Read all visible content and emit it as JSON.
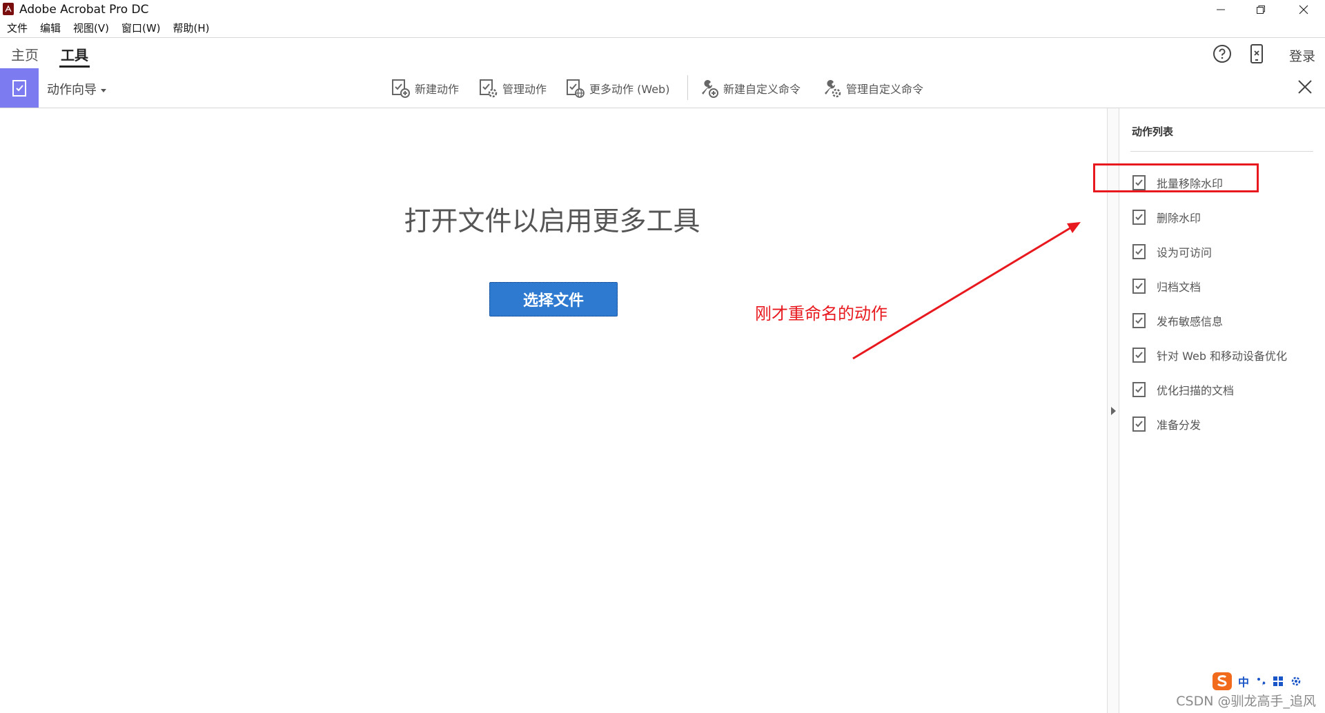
{
  "app": {
    "title": "Adobe Acrobat Pro DC",
    "logo_icon": "acrobat-logo"
  },
  "menu": [
    "文件",
    "编辑",
    "视图(V)",
    "窗口(W)",
    "帮助(H)"
  ],
  "tabs": {
    "home": "主页",
    "tools": "工具"
  },
  "topbar": {
    "login": "登录",
    "help_icon": "help-circle-icon",
    "device_icon": "mobile-device-icon"
  },
  "toolbar": {
    "wizard": "动作向导",
    "buttons": [
      "新建动作",
      "管理动作",
      "更多动作 (Web)",
      "新建自定义命令",
      "管理自定义命令"
    ],
    "accent": "#7c7cf0"
  },
  "main": {
    "heading": "打开文件以启用更多工具",
    "select_button": "选择文件",
    "button_color": "#2d7ad0"
  },
  "annotation": {
    "text": "刚才重命名的动作",
    "color": "#e8191e"
  },
  "panel": {
    "title": "动作列表",
    "actions": [
      "批量移除水印",
      "删除水印",
      "设为可访问",
      "归档文档",
      "发布敏感信息",
      "针对 Web 和移动设备优化",
      "优化扫描的文档",
      "准备分发"
    ]
  },
  "ime": {
    "label": "中"
  },
  "watermark": "CSDN @驯龙高手_追风"
}
